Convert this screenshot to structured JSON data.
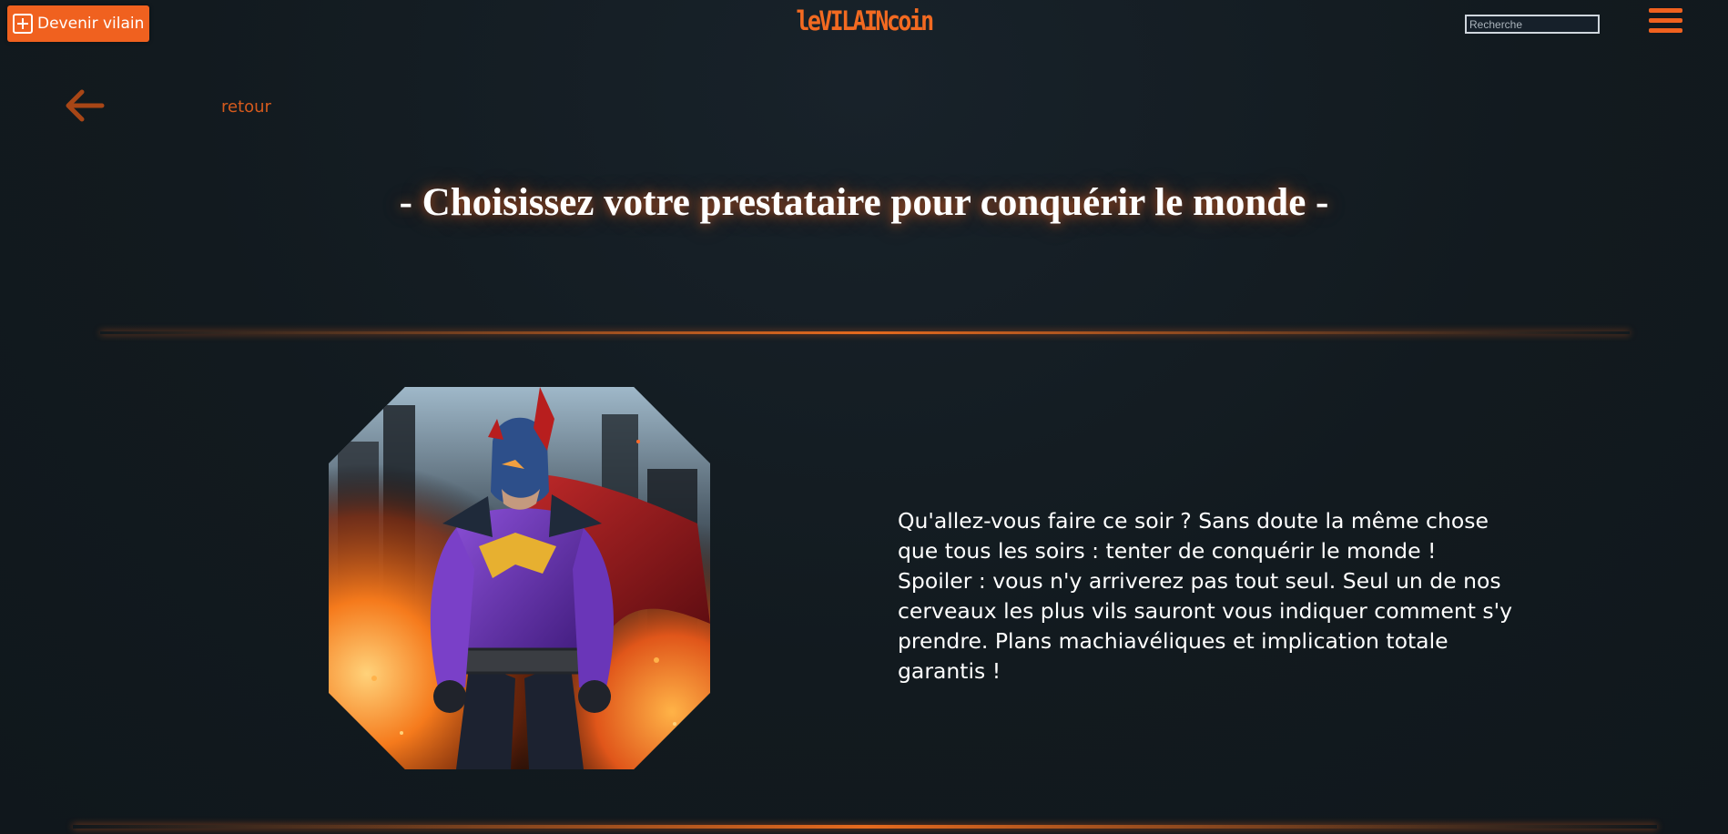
{
  "header": {
    "become_villain_label": "Devenir vilain",
    "logo_text": "leVILAINcoin",
    "search_placeholder": "Recherche"
  },
  "nav": {
    "back_label": "retour"
  },
  "main": {
    "title": "- Choisissez votre prestataire pour conquérir le monde -",
    "description": "Qu'allez-vous faire ce soir ? Sans doute la même chose que tous les soirs : tenter de conquérir le monde ! Spoiler : vous n'y arriverez pas tout seul. Seul un de nos cerveaux les plus vils sauront vous indiquer comment s'y prendre. Plans machiavéliques et implication totale garantis !"
  },
  "icons": {
    "plus": "plus-square-icon",
    "back": "arrow-left-icon",
    "menu": "hamburger-menu-icon"
  },
  "colors": {
    "accent": "#f0611f",
    "back_link": "#d55a1d",
    "background": "#121a1f",
    "text": "#ffffff"
  }
}
